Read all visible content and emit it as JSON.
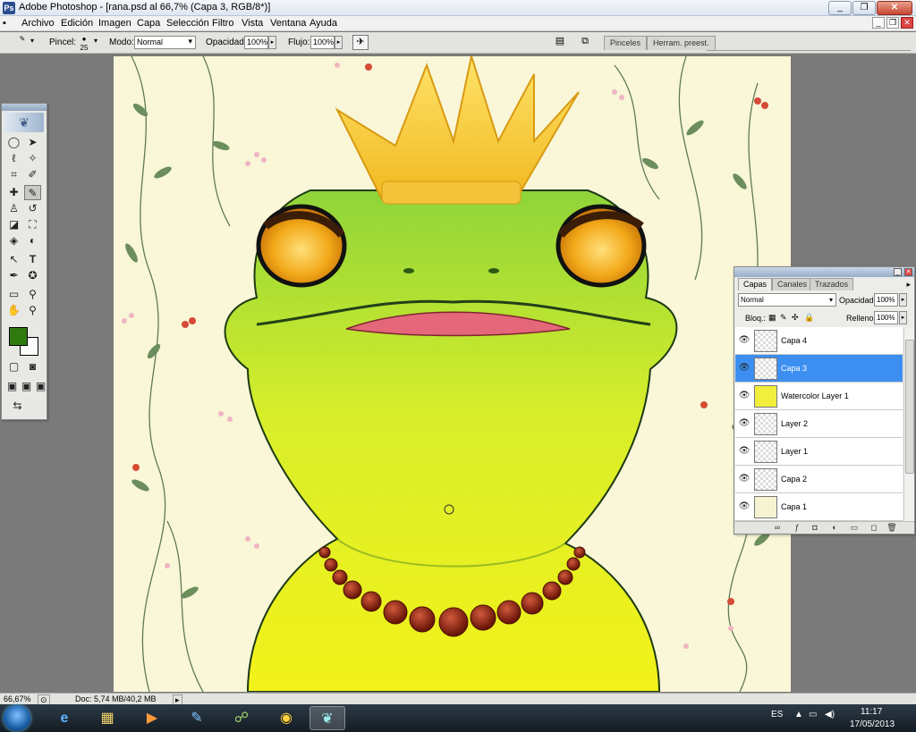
{
  "window": {
    "title": "Adobe Photoshop - [rana.psd al 66,7% (Capa 3, RGB/8*)]",
    "buttons": [
      "_",
      "❐",
      "✕"
    ]
  },
  "menu": [
    "Archivo",
    "Edición",
    "Imagen",
    "Capa",
    "Selección",
    "Filtro",
    "Vista",
    "Ventana",
    "Ayuda"
  ],
  "options": {
    "brush_label": "Pincel:",
    "brush_size": "25",
    "mode_label": "Modo:",
    "mode_value": "Normal",
    "opacity_label": "Opacidad:",
    "opacity_value": "100%",
    "flow_label": "Flujo:",
    "flow_value": "100%",
    "well_tabs": [
      "Pinceles",
      "Herram. preest."
    ]
  },
  "layers_panel": {
    "tabs": [
      "Capas",
      "Canales",
      "Trazados"
    ],
    "blend_mode": "Normal",
    "opacity_label": "Opacidad:",
    "opacity_value": "100%",
    "lock_label": "Bloq.:",
    "fill_label": "Relleno:",
    "fill_value": "100%",
    "layers": [
      {
        "name": "Capa 4",
        "selected": false
      },
      {
        "name": "Capa 3",
        "selected": true
      },
      {
        "name": "Watercolor Layer 1",
        "selected": false
      },
      {
        "name": "Layer 2",
        "selected": false
      },
      {
        "name": "Layer 1",
        "selected": false
      },
      {
        "name": "Capa 2",
        "selected": false
      },
      {
        "name": "Capa 1",
        "selected": false
      }
    ]
  },
  "status": {
    "zoom": "66,67%",
    "doc": "Doc: 5,74 MB/40,2 MB"
  },
  "taskbar": {
    "lang": "ES",
    "time": "11:17",
    "date": "17/05/2013"
  },
  "colors": {
    "foreground": "#2f7a0f",
    "background": "#ffffff",
    "selection": "#3c8ff0"
  }
}
